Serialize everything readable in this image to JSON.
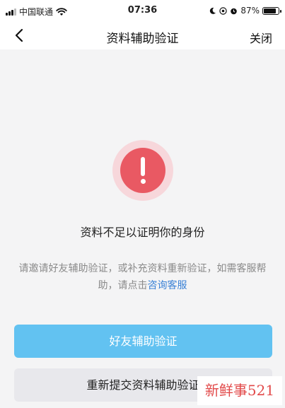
{
  "status_bar": {
    "carrier": "中国联通",
    "time": "07:36",
    "battery_percent": "87%",
    "battery_level": 0.87,
    "icons": [
      "signal-icon",
      "wifi-icon",
      "moon-icon",
      "at-icon",
      "alarm-icon",
      "battery-icon"
    ]
  },
  "nav": {
    "back_icon": "chevron-left-icon",
    "title": "资料辅助验证",
    "close_label": "关闭"
  },
  "alert": {
    "icon": "alert-icon",
    "colors": {
      "halo": "#f7d7db",
      "circle": "#e95963"
    }
  },
  "main": {
    "headline": "资料不足以证明你的身份",
    "description": "请邀请好友辅助验证，或补充资料重新验证，如需客服帮助，请点击",
    "description_link": "咨询客服"
  },
  "buttons": {
    "friend_verify": "好友辅助验证",
    "resubmit": "重新提交资料辅助验证"
  },
  "watermark": {
    "text": "新鲜事521"
  },
  "colors": {
    "primary_button": "#62c2f1",
    "secondary_button": "#e8e8ec",
    "link": "#3b82d6",
    "background": "#f4f4f5"
  }
}
